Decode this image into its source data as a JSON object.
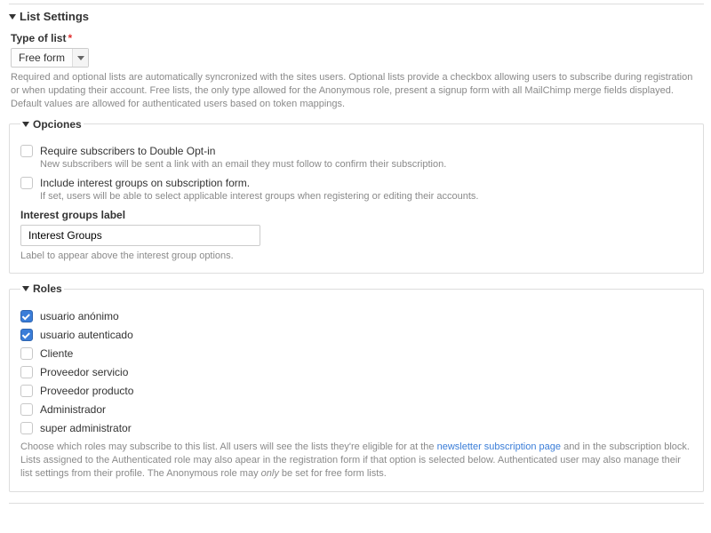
{
  "page_title": "List Settings",
  "type_of_list": {
    "label": "Type of list",
    "value": "Free form",
    "help": "Required and optional lists are automatically syncronized with the sites users. Optional lists provide a checkbox allowing users to subscribe during registration or when updating their account. Free lists, the only type allowed for the Anonymous role, present a signup form with all MailChimp merge fields displayed. Default values are allowed for authenticated users based on token mappings."
  },
  "opciones": {
    "legend": "Opciones",
    "double_opt_in": {
      "label": "Require subscribers to Double Opt-in",
      "desc": "New subscribers will be sent a link with an email they must follow to confirm their subscription.",
      "checked": false
    },
    "interest_groups": {
      "label": "Include interest groups on subscription form.",
      "desc": "If set, users will be able to select applicable interest groups when registering or editing their accounts.",
      "checked": false
    },
    "groups_label_field": {
      "label": "Interest groups label",
      "value": "Interest Groups",
      "desc": "Label to appear above the interest group options."
    }
  },
  "roles": {
    "legend": "Roles",
    "items": [
      {
        "label": "usuario anónimo",
        "checked": true
      },
      {
        "label": "usuario autenticado",
        "checked": true
      },
      {
        "label": "Cliente",
        "checked": false
      },
      {
        "label": "Proveedor servicio",
        "checked": false
      },
      {
        "label": "Proveedor producto",
        "checked": false
      },
      {
        "label": "Administrador",
        "checked": false
      },
      {
        "label": "super administrator",
        "checked": false
      }
    ],
    "help_pre": "Choose which roles may subscribe to this list. All users will see the lists they're eligible for at the ",
    "help_link": "newsletter subscription page",
    "help_mid": " and in the subscription block. Lists assigned to the Authenticated role may also apear in the registration form if that option is selected below. Authenticated user may also manage their list settings from their profile. The Anonymous role may ",
    "help_only_word": "only",
    "help_post": " be set for free form lists."
  }
}
